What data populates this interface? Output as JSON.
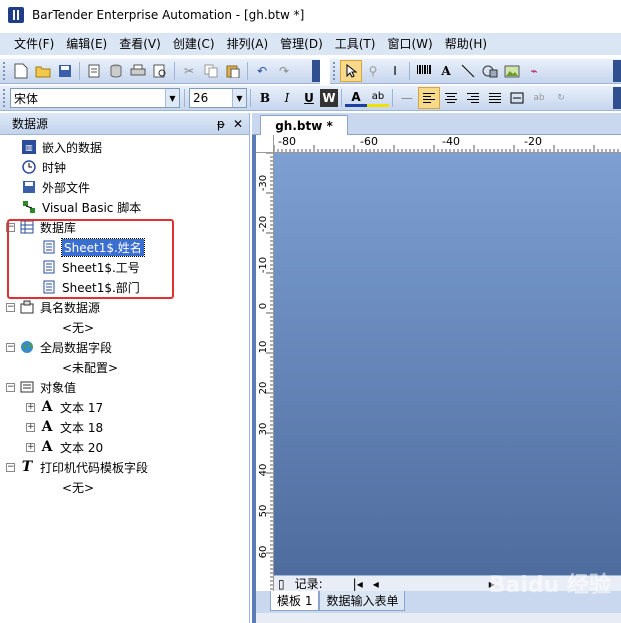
{
  "window": {
    "title": "BarTender Enterprise Automation - [gh.btw *]"
  },
  "menu": [
    "文件(F)",
    "编辑(E)",
    "查看(V)",
    "创建(C)",
    "排列(A)",
    "管理(D)",
    "工具(T)",
    "窗口(W)",
    "帮助(H)"
  ],
  "format_toolbar": {
    "font": "宋体",
    "size": "26",
    "bold": "B",
    "italic": "I",
    "underline": "U",
    "wordart": "W"
  },
  "panel": {
    "title": "数据源",
    "pin": "ᵽ",
    "close": "✕"
  },
  "tree": {
    "embedded": "嵌入的数据",
    "clock": "时钟",
    "external_file": "外部文件",
    "vb_script": "Visual Basic 脚本",
    "database": "数据库",
    "db_fields": [
      "Sheet1$.姓名",
      "Sheet1$.工号",
      "Sheet1$.部门"
    ],
    "named_sources": "具名数据源",
    "named_none": "<无>",
    "global_fields": "全局数据字段",
    "global_unconfigured": "<未配置>",
    "object_values": "对象值",
    "objects": [
      "文本 17",
      "文本 18",
      "文本 20"
    ],
    "printer_template": "打印机代码模板字段",
    "printer_none": "<无>"
  },
  "document": {
    "tab": "gh.btw *",
    "ruler_h": [
      "-80",
      "-60",
      "-40",
      "-20"
    ],
    "ruler_v": [
      "-30",
      "-20",
      "-10",
      "0",
      "10",
      "20",
      "30",
      "40",
      "50",
      "60"
    ],
    "record_label": "记录:",
    "bottom_tabs": [
      "模板 1",
      "数据输入表单"
    ],
    "watermark": "Baidu 经验"
  },
  "colors": {
    "accent": "#3a6ed0",
    "highlight_box": "#e03030",
    "canvas": "#5a7eb5"
  }
}
